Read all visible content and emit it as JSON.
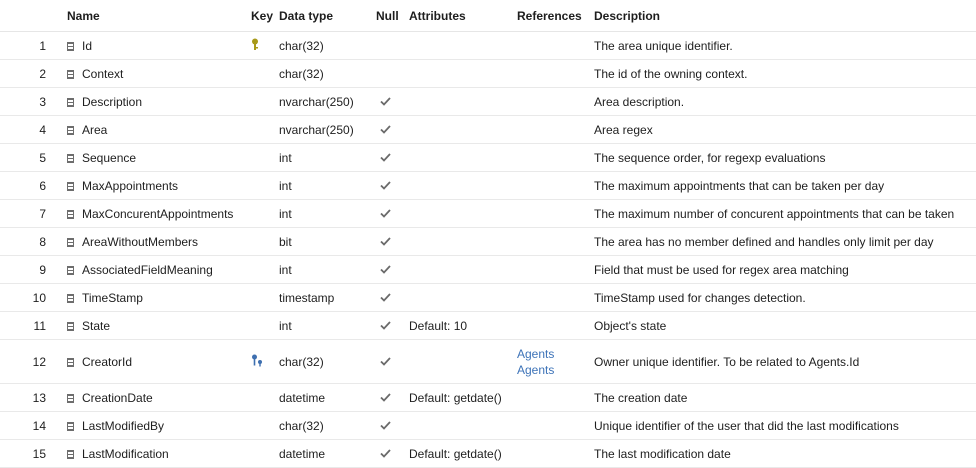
{
  "headers": {
    "name": "Name",
    "key": "Key",
    "type": "Data type",
    "null": "Null",
    "attributes": "Attributes",
    "references": "References",
    "description": "Description"
  },
  "rows": [
    {
      "num": "1",
      "name": "Id",
      "key": "primary-key",
      "type": "char(32)",
      "null": false,
      "attr": "",
      "refs": [],
      "desc": "The area unique identifier."
    },
    {
      "num": "2",
      "name": "Context",
      "key": "",
      "type": "char(32)",
      "null": false,
      "attr": "",
      "refs": [],
      "desc": "The id of the owning context."
    },
    {
      "num": "3",
      "name": "Description",
      "key": "",
      "type": "nvarchar(250)",
      "null": true,
      "attr": "",
      "refs": [],
      "desc": "Area description."
    },
    {
      "num": "4",
      "name": "Area",
      "key": "",
      "type": "nvarchar(250)",
      "null": true,
      "attr": "",
      "refs": [],
      "desc": "Area regex"
    },
    {
      "num": "5",
      "name": "Sequence",
      "key": "",
      "type": "int",
      "null": true,
      "attr": "",
      "refs": [],
      "desc": "The sequence order, for regexp evaluations"
    },
    {
      "num": "6",
      "name": "MaxAppointments",
      "key": "",
      "type": "int",
      "null": true,
      "attr": "",
      "refs": [],
      "desc": "The maximum appointments that can be taken per day"
    },
    {
      "num": "7",
      "name": "MaxConcurentAppointments",
      "key": "",
      "type": "int",
      "null": true,
      "attr": "",
      "refs": [],
      "desc": "The maximum number of concurent appointments that can be taken"
    },
    {
      "num": "8",
      "name": "AreaWithoutMembers",
      "key": "",
      "type": "bit",
      "null": true,
      "attr": "",
      "refs": [],
      "desc": "The area has no member defined and handles only limit per day"
    },
    {
      "num": "9",
      "name": "AssociatedFieldMeaning",
      "key": "",
      "type": "int",
      "null": true,
      "attr": "",
      "refs": [],
      "desc": "Field that must be used for regex area matching"
    },
    {
      "num": "10",
      "name": "TimeStamp",
      "key": "",
      "type": "timestamp",
      "null": true,
      "attr": "",
      "refs": [],
      "desc": "TimeStamp used for changes detection."
    },
    {
      "num": "11",
      "name": "State",
      "key": "",
      "type": "int",
      "null": true,
      "attr": "Default: 10",
      "refs": [],
      "desc": "Object's state"
    },
    {
      "num": "12",
      "name": "CreatorId",
      "key": "foreign-key",
      "type": "char(32)",
      "null": true,
      "attr": "",
      "refs": [
        "Agents",
        "Agents"
      ],
      "desc": "Owner unique identifier. To be related to Agents.Id"
    },
    {
      "num": "13",
      "name": "CreationDate",
      "key": "",
      "type": "datetime",
      "null": true,
      "attr": "Default: getdate()",
      "refs": [],
      "desc": "The creation date"
    },
    {
      "num": "14",
      "name": "LastModifiedBy",
      "key": "",
      "type": "char(32)",
      "null": true,
      "attr": "",
      "refs": [],
      "desc": "Unique identifier of the user that did the last modifications"
    },
    {
      "num": "15",
      "name": "LastModification",
      "key": "",
      "type": "datetime",
      "null": true,
      "attr": "Default: getdate()",
      "refs": [],
      "desc": "The last modification date"
    }
  ],
  "colors": {
    "primary_key": "#a89a1a",
    "foreign_key": "#3e6fb0",
    "link": "#3d73b8",
    "check": "#6a6a6a"
  },
  "icons": {
    "column": "column-icon",
    "null_check": "checkmark-icon",
    "primary_key": "key-icon",
    "foreign_key": "foreign-key-icon"
  }
}
